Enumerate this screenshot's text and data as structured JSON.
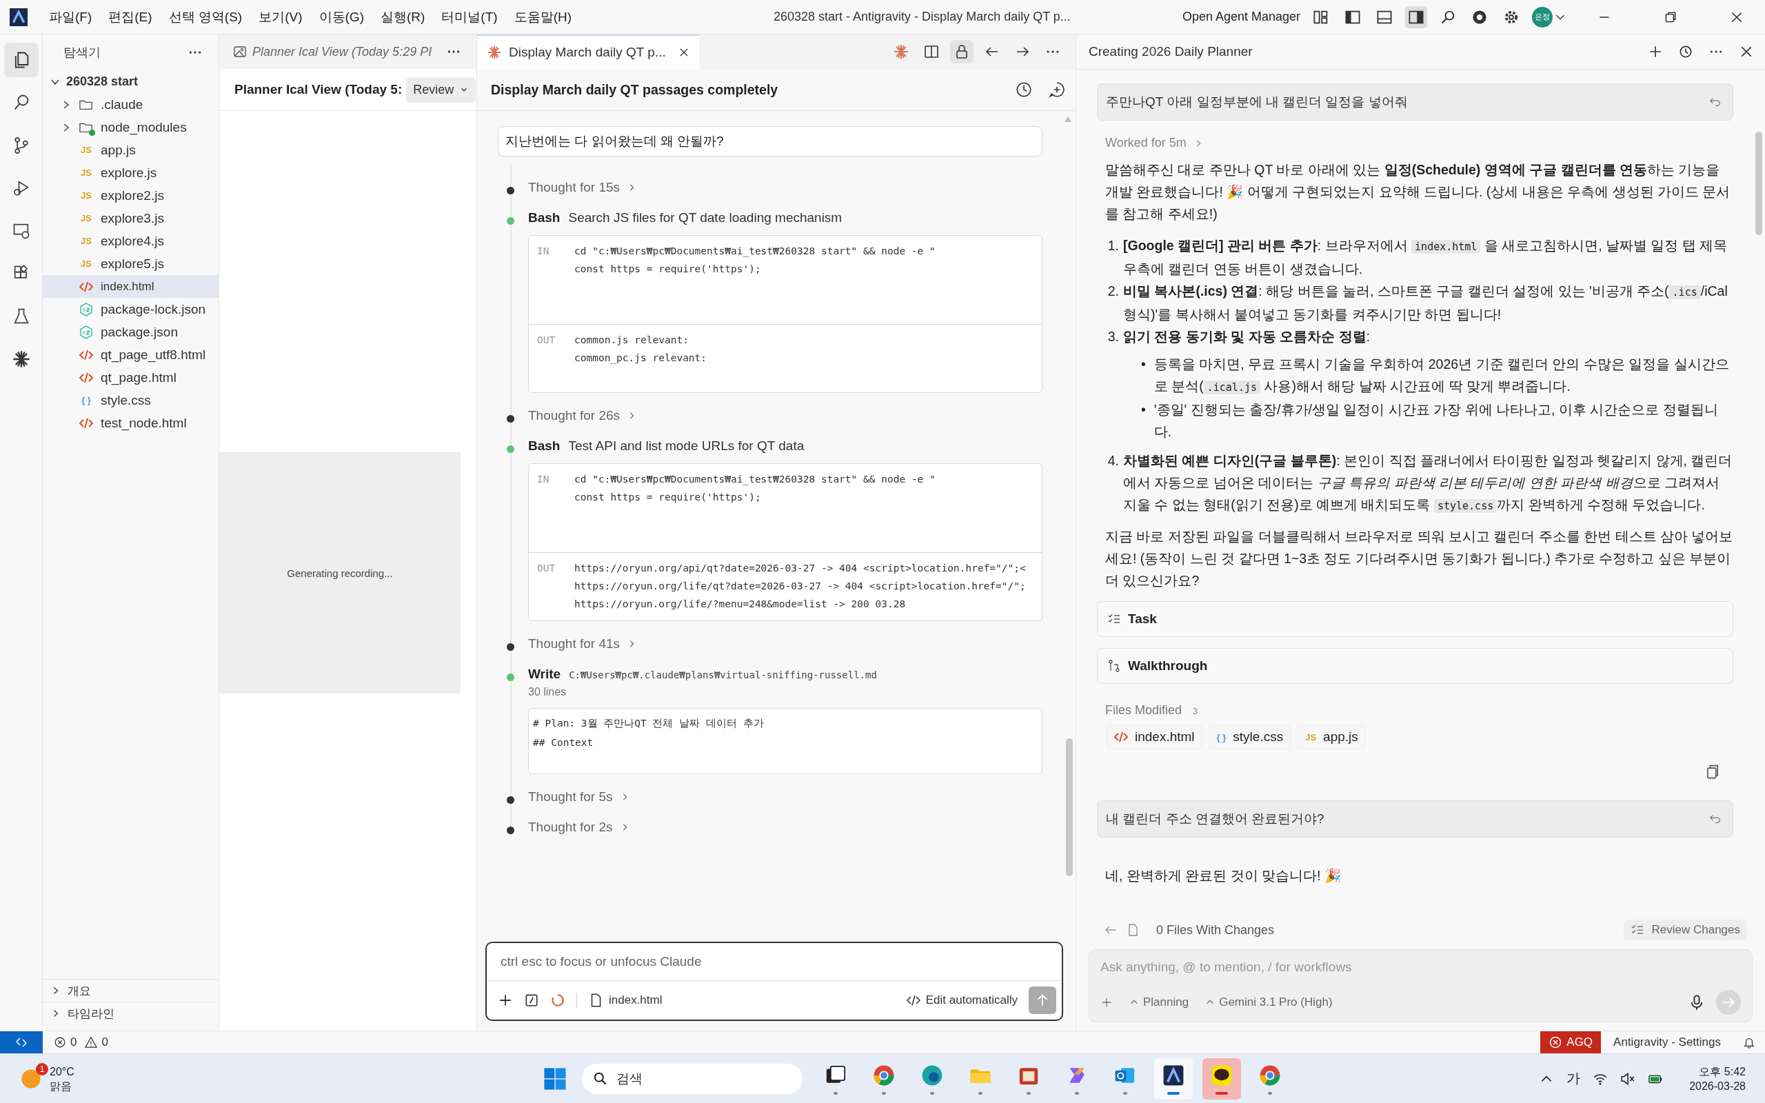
{
  "title_bar": {
    "menu": [
      "파일(F)",
      "편집(E)",
      "선택 영역(S)",
      "보기(V)",
      "이동(G)",
      "실행(R)",
      "터미널(T)",
      "도움말(H)"
    ],
    "title": "260328 start - Antigravity - Display March daily QT p...",
    "agent_manager": "Open Agent Manager",
    "avatar_text": "은정"
  },
  "activity_bar": [
    {
      "kind": "explorer",
      "selected": true
    },
    {
      "kind": "search",
      "selected": false
    },
    {
      "kind": "source-control",
      "selected": false
    },
    {
      "kind": "run",
      "selected": false
    },
    {
      "kind": "remote",
      "selected": false
    },
    {
      "kind": "extensions",
      "selected": false
    },
    {
      "kind": "testing",
      "selected": false
    },
    {
      "kind": "claude",
      "selected": false
    }
  ],
  "explorer": {
    "title": "탐색기",
    "root": {
      "label": "260328 start",
      "expanded": true,
      "children": [
        {
          "label": ".claude",
          "kind": "folder",
          "expanded": false,
          "has_changes": false,
          "selected": false
        },
        {
          "label": "node_modules",
          "kind": "folder",
          "expanded": false,
          "has_changes": true,
          "selected": false
        },
        {
          "label": "app.js",
          "kind": "js",
          "icon_text": "JS",
          "has_changes": false,
          "selected": false
        },
        {
          "label": "explore.js",
          "kind": "js",
          "icon_text": "JS",
          "has_changes": false,
          "selected": false
        },
        {
          "label": "explore2.js",
          "kind": "js",
          "icon_text": "JS",
          "has_changes": false,
          "selected": false
        },
        {
          "label": "explore3.js",
          "kind": "js",
          "icon_text": "JS",
          "has_changes": false,
          "selected": false
        },
        {
          "label": "explore4.js",
          "kind": "js",
          "icon_text": "JS",
          "has_changes": false,
          "selected": false
        },
        {
          "label": "explore5.js",
          "kind": "js",
          "icon_text": "JS",
          "has_changes": false,
          "selected": false
        },
        {
          "label": "index.html",
          "kind": "html",
          "has_changes": false,
          "selected": true
        },
        {
          "label": "package-lock.json",
          "kind": "json",
          "has_changes": false,
          "selected": false
        },
        {
          "label": "package.json",
          "kind": "json",
          "has_changes": false,
          "selected": false
        },
        {
          "label": "qt_page_utf8.html",
          "kind": "html",
          "has_changes": false,
          "selected": false
        },
        {
          "label": "qt_page.html",
          "kind": "html",
          "has_changes": false,
          "selected": false
        },
        {
          "label": "style.css",
          "kind": "css",
          "icon_text": "{ }",
          "has_changes": false,
          "selected": false
        },
        {
          "label": "test_node.html",
          "kind": "html",
          "has_changes": false,
          "selected": false
        }
      ]
    },
    "sections": [
      {
        "label": "개요",
        "expanded": false
      },
      {
        "label": "타임라인",
        "expanded": false
      }
    ]
  },
  "preview_editor": {
    "tab": "Planner Ical View (Today 5:29 PI",
    "heading": "Planner Ical View (Today 5:",
    "review_button": "Review",
    "status": "Generating recording..."
  },
  "claude_chat": {
    "tab": "Display March daily QT p...",
    "title": "Display March daily QT passages completely",
    "user_message": "지난번에는 다 읽어왔는데 왜 안될까?",
    "steps": [
      {
        "kind": "thought",
        "label": "Thought for 15s"
      },
      {
        "kind": "bash",
        "tool": "Bash",
        "summary": "Search JS files for QT date loading mechanism",
        "input_label": "IN",
        "input": [
          "cd \"c:₩Users₩pc₩Documents₩ai_test₩260328 start\" && node -e \"",
          "const https = require('https');"
        ],
        "output_label": "OUT",
        "output": [
          "common.js relevant:",
          "common_pc.js relevant:"
        ]
      },
      {
        "kind": "thought",
        "label": "Thought for 26s"
      },
      {
        "kind": "bash",
        "tool": "Bash",
        "summary": "Test API and list mode URLs for QT data",
        "input_label": "IN",
        "input": [
          "cd \"c:₩Users₩pc₩Documents₩ai_test₩260328 start\" && node -e \"",
          "const https = require('https');"
        ],
        "output_label": "OUT",
        "output": [
          "https://oryun.org/api/qt?date=2026-03-27 -> 404 <script>location.href=\"/\";<",
          "https://oryun.org/life/qt?date=2026-03-27 -> 404 <script>location.href=\"/\";",
          "https://oryun.org/life/?menu=248&mode=list -> 200 03.28"
        ]
      },
      {
        "kind": "thought",
        "label": "Thought for 41s"
      },
      {
        "kind": "write",
        "tool": "Write",
        "path": "C:₩Users₩pc₩.claude₩plans₩virtual-sniffing-russell.md",
        "meta": "30 lines",
        "content": [
          "# Plan: 3월 주만나QT 전체 날짜 데이터 추가",
          "## Context"
        ]
      },
      {
        "kind": "thought",
        "label": "Thought for 5s"
      },
      {
        "kind": "thought",
        "label": "Thought for 2s"
      }
    ],
    "input_placeholder": "ctrl esc to focus or unfocus Claude",
    "attached_file": "index.html",
    "mode": "Edit automatically"
  },
  "agent_panel": {
    "title": "Creating 2026 Daily Planner",
    "user_message": "주만나QT 아래 일정부분에 내 캘린더 일정을 넣어줘",
    "worked": "Worked for 5m",
    "response": [
      {
        "kind": "paragraph",
        "segments": [
          {
            "kind": "text",
            "text": "말씀해주신 대로 주만나 QT 바로 아래에 있는 **일정(Schedule) 영역에 구글 캘린더를 연동**하는 기능을 개발 완료했습니다! 🎉 어떻게 구현되었는지 요약해 드립니다. (상세 내용은 우측에 생성된 가이드 문서를 참고해 주세요!)"
          }
        ]
      },
      {
        "kind": "numbered",
        "items": [
          {
            "number": "1.",
            "segments": [
              {
                "kind": "text",
                "text": "**[Google 캘린더] 관리 버튼 추가**: 브라우저에서 "
              },
              {
                "kind": "code",
                "text": "index.html"
              },
              {
                "kind": "text",
                "text": " 을 새로고침하시면, 날짜별 일정 탭 제목 우측에 캘린더 연동 버튼이 생겼습니다."
              }
            ]
          },
          {
            "number": "2.",
            "segments": [
              {
                "kind": "text",
                "text": "**비밀 복사본(.ics) 연결**: 해당 버튼을 눌러, 스마트폰 구글 캘린더 설정에 있는 '비공개 주소("
              },
              {
                "kind": "code",
                "text": ".ics"
              },
              {
                "kind": "text",
                "text": "/iCal 형식)'를 복사해서 붙여넣고 동기화를 켜주시기만 하면 됩니다!"
              }
            ]
          },
          {
            "number": "3.",
            "segments": [
              {
                "kind": "text",
                "text": "**읽기 전용 동기화 및 자동 오름차순 정렬**:"
              }
            ],
            "bullets": [
              {
                "marker": "•",
                "segments": [
                  {
                    "kind": "text",
                    "text": "등록을 마치면, 무료 프록시 기술을 우회하여 2026년 기준 캘린더 안의 수많은 일정을 실시간으로 분석("
                  },
                  {
                    "kind": "code",
                    "text": ".ical.js"
                  },
                  {
                    "kind": "text",
                    "text": " 사용)해서 해당 날짜 시간표에 딱 맞게 뿌려줍니다."
                  }
                ]
              },
              {
                "marker": "•",
                "segments": [
                  {
                    "kind": "text",
                    "text": "'종일' 진행되는 출장/휴가/생일 일정이 시간표 가장 위에 나타나고, 이후 시간순으로 정렬됩니다."
                  }
                ]
              }
            ]
          },
          {
            "number": "4.",
            "segments": [
              {
                "kind": "text",
                "text": "**차별화된 예쁜 디자인(구글 블루톤)**: 본인이 직접 플래너에서 타이핑한 일정과 헷갈리지 않게, 캘린더에서 자동으로 넘어온 데이터는 "
              },
              {
                "kind": "italic",
                "text": "구글 특유의 파란색 리본 테두리에 연한 파란색 배경"
              },
              {
                "kind": "text",
                "text": "으로 그려져서 지울 수 없는 형태(읽기 전용)로 예쁘게 배치되도록 "
              },
              {
                "kind": "code",
                "text": "style.css"
              },
              {
                "kind": "text",
                "text": "까지 완벽하게 수정해 두었습니다."
              }
            ]
          }
        ]
      },
      {
        "kind": "paragraph",
        "segments": [
          {
            "kind": "text",
            "text": "지금 바로 저장된 파일을 더블클릭해서 브라우저로 띄워 보시고 캘린더 주소를 한번 테스트 삼아 넣어보세요! (동작이 느린 것 같다면 1~3초 정도 기다려주시면 동기화가 됩니다.) 추가로 수정하고 싶은 부분이 더 있으신가요?"
          }
        ]
      }
    ],
    "artifacts": [
      {
        "kind": "task",
        "label": "Task"
      },
      {
        "kind": "walkthrough",
        "label": "Walkthrough"
      }
    ],
    "files_modified": {
      "label": "Files Modified",
      "count": "3",
      "files": [
        {
          "kind": "html",
          "name": "index.html"
        },
        {
          "kind": "css",
          "name": "style.css",
          "icon_text": "{ }"
        },
        {
          "kind": "js",
          "name": "app.js",
          "icon_text": "JS"
        }
      ]
    },
    "second_message": "내 캘린더 주소 연결했어 완료된거야?",
    "second_reply": "네, 완벽하게 완료된 것이 맞습니다! 🎉",
    "changes": "0 Files With Changes",
    "review_button": "Review Changes",
    "input_placeholder": "Ask anything, @ to mention, / for workflows",
    "mode": "Planning",
    "model": "Gemini 3.1 Pro (High)"
  },
  "status_bar": {
    "errors": "0",
    "warnings": "0",
    "badge": "AGQ",
    "settings": "Antigravity - Settings"
  },
  "taskbar": {
    "weather_badge": "1",
    "temperature": "20°C",
    "condition": "맑음",
    "search_placeholder": "검색",
    "apps": [
      {
        "kind": "task-view",
        "selected": false,
        "attention": false
      },
      {
        "kind": "chrome",
        "selected": false,
        "attention": false
      },
      {
        "kind": "edge",
        "selected": false,
        "attention": false
      },
      {
        "kind": "files",
        "selected": false,
        "attention": false
      },
      {
        "kind": "app",
        "selected": false,
        "attention": false
      },
      {
        "kind": "copilot",
        "selected": false,
        "attention": false
      },
      {
        "kind": "outlook",
        "selected": false,
        "attention": false
      },
      {
        "kind": "antigravity",
        "selected": true,
        "attention": false
      },
      {
        "kind": "chat",
        "selected": false,
        "attention": true
      },
      {
        "kind": "chrome",
        "selected": false,
        "attention": false
      }
    ],
    "ime": "가",
    "time": "오후 5:42",
    "date": "2026-03-28"
  }
}
